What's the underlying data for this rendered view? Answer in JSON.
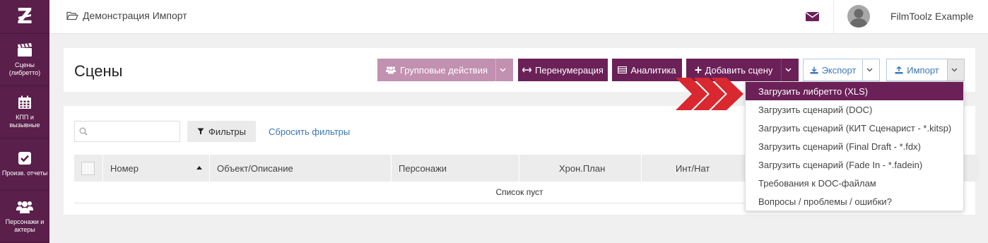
{
  "sidebar": {
    "logo": "Z",
    "items": [
      {
        "label": "Сцены (либретто)",
        "icon": "clapperboard-icon"
      },
      {
        "label": "КПП и вызывные",
        "icon": "calendar-icon"
      },
      {
        "label": "Произв. отчеты",
        "icon": "check-square-icon"
      },
      {
        "label": "Персонажи и актеры",
        "icon": "users-icon"
      }
    ]
  },
  "topbar": {
    "breadcrumb": "Демонстрация Импорт",
    "username": "FilmToolz Example"
  },
  "header": {
    "title": "Сцены",
    "group_actions_label": "Групповые действия",
    "renumber_label": "Перенумерация",
    "analytics_label": "Аналитика",
    "add_scene_label": "Добавить сцену",
    "export_label": "Экспорт",
    "import_label": "Импорт"
  },
  "list": {
    "search_placeholder": "",
    "filters_label": "Фильтры",
    "reset_filters_label": "Сбросить фильтры",
    "columns": [
      "Номер",
      "Объект/Описание",
      "Персонажи",
      "Хрон.План",
      "Инт/Нат"
    ],
    "empty_text": "Список пуст"
  },
  "import_menu": {
    "items": [
      "Загрузить либретто (XLS)",
      "Загрузить сценарий (DOC)",
      "Загрузить сценарий (КИТ Сценарист - *.kitsp)",
      "Загрузить сценарий (Final Draft - *.fdx)",
      "Загрузить сценарий (Fade In - *.fadein)",
      "Требования к DOC-файлам",
      "Вопросы / проблемы / ошибки?"
    ],
    "highlighted_index": 0
  },
  "colors": {
    "brand": "#6b2158",
    "sidebar": "#5a1f4b",
    "muted_button": "#c290b0",
    "link": "#3a78b5",
    "arrow": "#d9282f"
  }
}
